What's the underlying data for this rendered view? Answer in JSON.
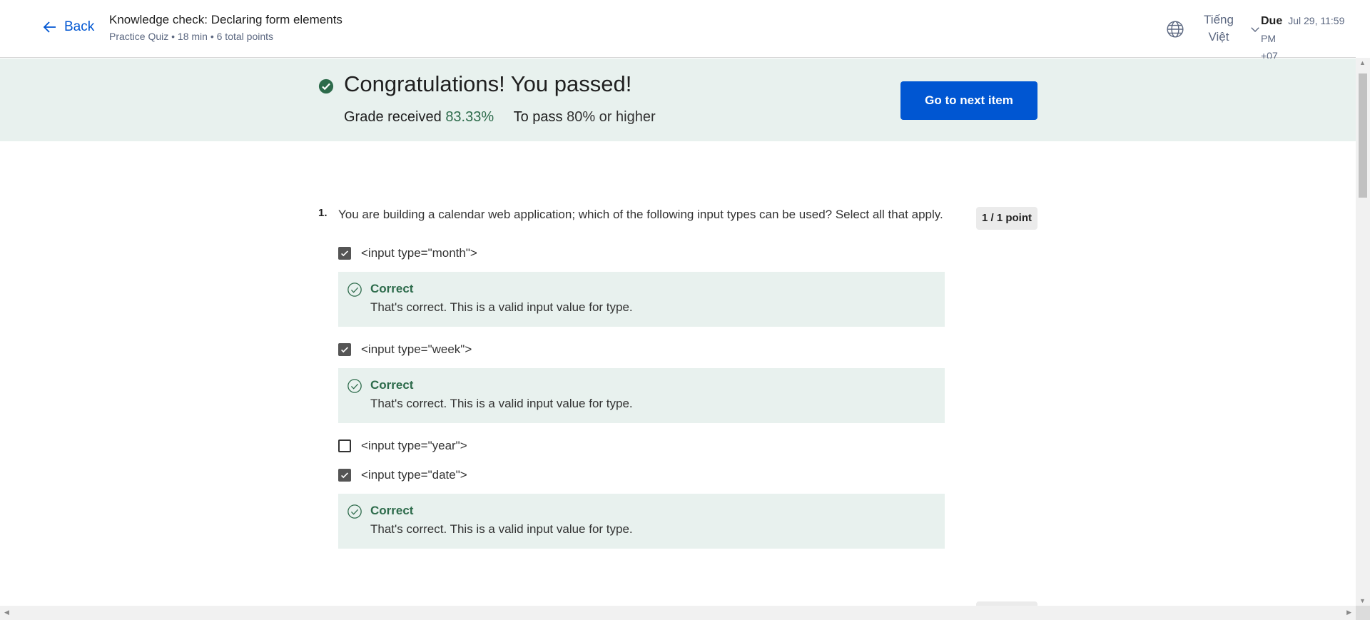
{
  "header": {
    "back_label": "Back",
    "quiz_title": "Knowledge check: Declaring form elements",
    "quiz_meta": "Practice Quiz • 18 min • 6 total points",
    "language_line1": "Tiếng",
    "language_line2": "Việt",
    "due_label": "Due",
    "due_date": "Jul 29, 11:59 PM",
    "due_tz": "+07"
  },
  "banner": {
    "title": "Congratulations! You passed!",
    "grade_label": "Grade received",
    "grade_value": "83.33%",
    "pass_label": "To pass",
    "pass_value": "80% or higher",
    "next_button": "Go to next item"
  },
  "question": {
    "number": "1.",
    "text": "You are building a calendar web application; which of the following input types can be used? Select all that apply.",
    "points": "1 / 1 point",
    "options": [
      {
        "label": "<input type=\"month\">",
        "checked": true,
        "feedback_title": "Correct",
        "feedback_text": "That's correct. This is a valid input value for type."
      },
      {
        "label": "<input type=\"week\">",
        "checked": true,
        "feedback_title": "Correct",
        "feedback_text": "That's correct. This is a valid input value for type."
      },
      {
        "label": "<input type=\"year\">",
        "checked": false
      },
      {
        "label": "<input type=\"date\">",
        "checked": true,
        "feedback_title": "Correct",
        "feedback_text": "That's correct. This is a valid input value for type."
      }
    ]
  },
  "colors": {
    "accent": "#0056d2",
    "success": "#2d6b4b",
    "banner_bg": "#e8f1ee"
  },
  "icons": [
    "arrow-left-icon",
    "globe-icon",
    "chevron-down-icon",
    "check-circle-icon",
    "checkmark-icon",
    "check-circle-outline-icon"
  ]
}
